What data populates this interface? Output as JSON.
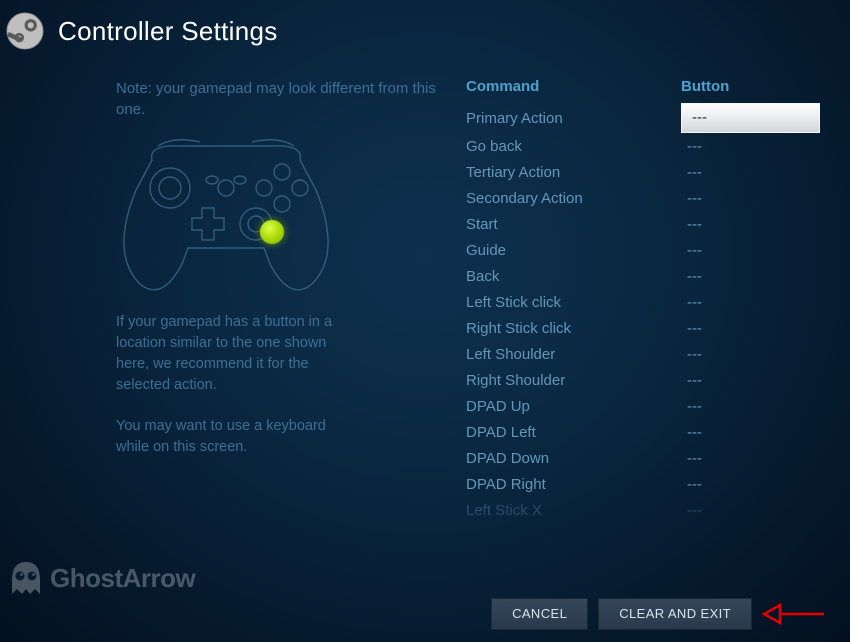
{
  "header": {
    "title": "Controller Settings"
  },
  "left": {
    "note_top": "Note: your gamepad may look different from this one.",
    "note_mid": "If your gamepad has a button in a location similar to the one shown here, we recommend it for the selected action.",
    "note_bot": "You may want to use a keyboard while on this screen."
  },
  "columns": {
    "command": "Command",
    "button": "Button"
  },
  "bindings": [
    {
      "command": "Primary Action",
      "button": "---",
      "active": true
    },
    {
      "command": "Go back",
      "button": "---"
    },
    {
      "command": "Tertiary Action",
      "button": "---"
    },
    {
      "command": "Secondary Action",
      "button": "---"
    },
    {
      "command": "Start",
      "button": "---"
    },
    {
      "command": "Guide",
      "button": "---"
    },
    {
      "command": "Back",
      "button": "---"
    },
    {
      "command": "Left Stick click",
      "button": "---"
    },
    {
      "command": "Right Stick click",
      "button": "---"
    },
    {
      "command": "Left Shoulder",
      "button": "---"
    },
    {
      "command": "Right Shoulder",
      "button": "---"
    },
    {
      "command": "DPAD Up",
      "button": "---"
    },
    {
      "command": "DPAD Left",
      "button": "---"
    },
    {
      "command": "DPAD Down",
      "button": "---"
    },
    {
      "command": "DPAD Right",
      "button": "---"
    },
    {
      "command": "Left Stick X",
      "button": "---",
      "fade": true
    }
  ],
  "footer": {
    "cancel": "CANCEL",
    "clear_exit": "CLEAR AND EXIT"
  },
  "watermark": "GhostArrow"
}
